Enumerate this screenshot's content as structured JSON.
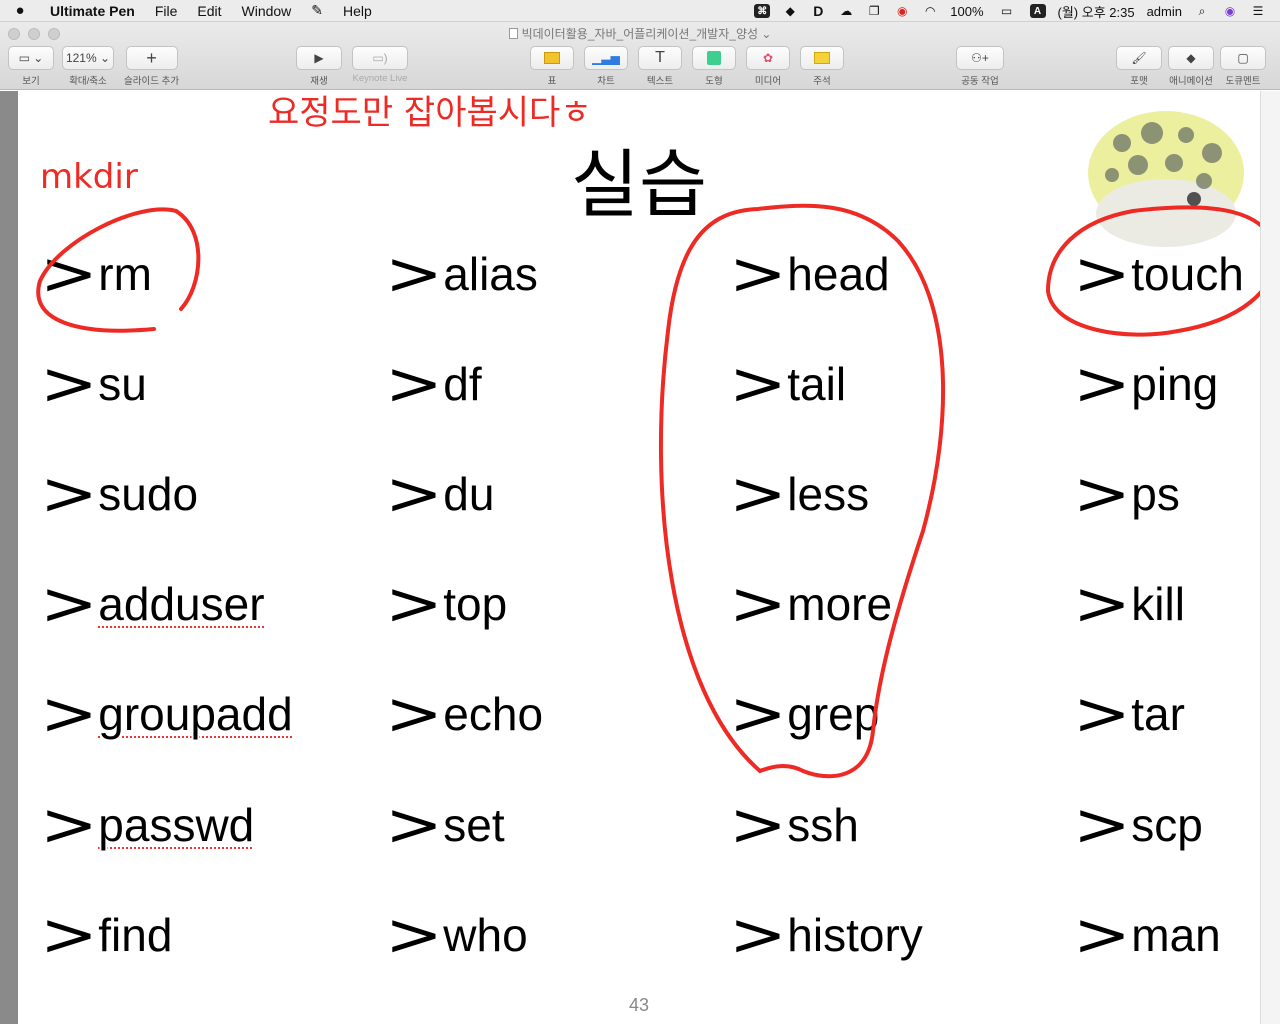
{
  "menubar": {
    "app": "Ultimate Pen",
    "menus": [
      "File",
      "Edit",
      "Window",
      "Help"
    ],
    "status": {
      "battery": "100%",
      "clock": "(월) 오후 2:35",
      "user": "admin",
      "input_source": "A"
    }
  },
  "window": {
    "title": "빅데이터활용_자바_어플리케이션_개발자_양성"
  },
  "toolbar": {
    "view_label": "보기",
    "zoom_value": "121%",
    "zoom_label": "확대/축소",
    "add_slide_label": "슬라이드 추가",
    "play_label": "재생",
    "keynote_live_label": "Keynote Live",
    "table_label": "표",
    "chart_label": "차트",
    "text_label": "텍스트",
    "shape_label": "도형",
    "media_label": "미디어",
    "comment_label": "주석",
    "collaborate_label": "공동 작업",
    "format_label": "포맷",
    "animate_label": "애니메이션",
    "document_label": "도큐멘트"
  },
  "slide": {
    "title": "실습",
    "annotation_top": "요정도만 잡아봅시다ㅎ",
    "annotation_mkdir": "mkdir",
    "prompt": ">",
    "page_number": "43",
    "columns": [
      [
        "rm",
        "su",
        "sudo",
        "adduser",
        "groupadd",
        "passwd",
        "find"
      ],
      [
        "alias",
        "df",
        "du",
        "top",
        "echo",
        "set",
        "who"
      ],
      [
        "head",
        "tail",
        "less",
        "more",
        "grep",
        "ssh",
        "history"
      ],
      [
        "touch",
        "ping",
        "ps",
        "kill",
        "tar",
        "scp",
        "man"
      ]
    ],
    "spellcheck_flagged": [
      "adduser",
      "groupadd",
      "passwd"
    ],
    "annotation_color": "#ee2a24"
  }
}
